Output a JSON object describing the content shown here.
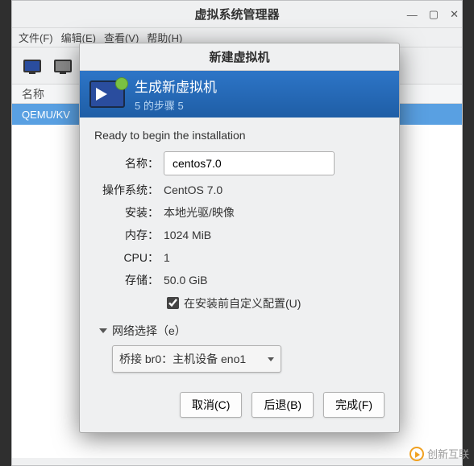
{
  "main_window": {
    "title": "虚拟系统管理器",
    "menus": {
      "file": "文件(F)",
      "edit": "编辑(E)",
      "view": "查看(V)",
      "help": "帮助(H)"
    },
    "column_header": "名称",
    "selected_row": "QEMU/KV"
  },
  "dialog": {
    "title": "新建虚拟机",
    "heading": "生成新虚拟机",
    "step": "5 的步骤 5",
    "ready": "Ready to begin the installation",
    "labels": {
      "name": "名称：",
      "os": "操作系统：",
      "install": "安装：",
      "memory": "内存：",
      "cpu": "CPU：",
      "storage": "存储："
    },
    "values": {
      "name": "centos7.0",
      "os": "CentOS 7.0",
      "install": "本地光驱/映像",
      "memory": "1024 MiB",
      "cpu": "1",
      "storage": "50.0 GiB"
    },
    "customize": {
      "checked": true,
      "label": "在安装前自定义配置(U)"
    },
    "network": {
      "expander": "网络选择（e）",
      "selected": "桥接 br0：主机设备 eno1"
    },
    "buttons": {
      "cancel": "取消(C)",
      "back": "后退(B)",
      "finish": "完成(F)"
    }
  },
  "watermark": "创新互联"
}
